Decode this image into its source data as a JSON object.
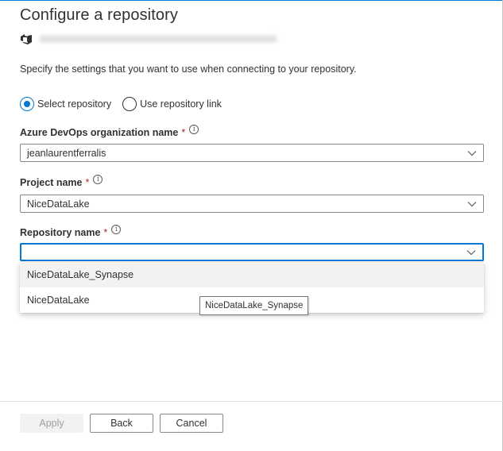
{
  "panel": {
    "title": "Configure a repository",
    "description": "Specify the settings that you want to use when connecting to your repository."
  },
  "account": {
    "icon": "azure-devops-icon"
  },
  "repo_source": {
    "options": [
      {
        "label": "Select repository",
        "checked": true
      },
      {
        "label": "Use repository link",
        "checked": false
      }
    ]
  },
  "fields": {
    "organization": {
      "label": "Azure DevOps organization name",
      "required": "*",
      "info": "i",
      "value": "jeanlaurentferralis"
    },
    "project": {
      "label": "Project name",
      "required": "*",
      "info": "i",
      "value": "NiceDataLake"
    },
    "repository": {
      "label": "Repository name",
      "required": "*",
      "info": "i",
      "value": ""
    }
  },
  "repository_dropdown": {
    "options": [
      "NiceDataLake_Synapse",
      "NiceDataLake"
    ],
    "highlighted": "NiceDataLake_Synapse"
  },
  "tooltip": {
    "text": "NiceDataLake_Synapse"
  },
  "footer": {
    "apply_label": "Apply",
    "back_label": "Back",
    "cancel_label": "Cancel"
  },
  "colors": {
    "accent": "#0078d4",
    "required": "#a4262c",
    "text": "#323130",
    "disabled_bg": "#f3f2f1"
  }
}
